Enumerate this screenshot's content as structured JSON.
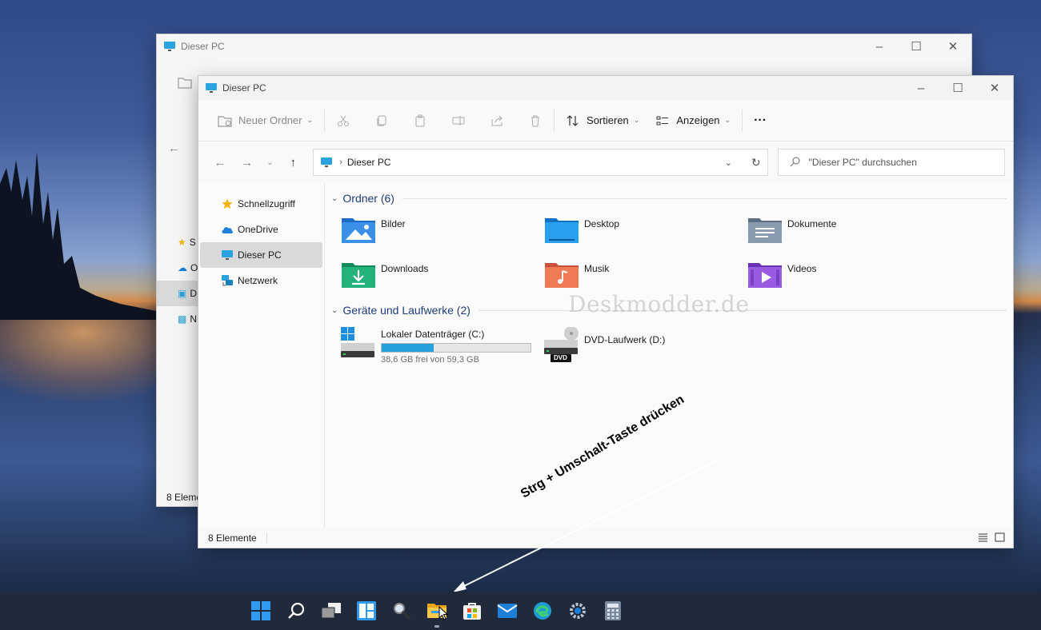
{
  "back_window": {
    "title": "Dieser PC",
    "nav_letters": [
      "S",
      "O",
      "D",
      "N"
    ],
    "status": "8 Eleme"
  },
  "window": {
    "title": "Dieser PC",
    "toolbar": {
      "new_folder": "Neuer Ordner",
      "sort": "Sortieren",
      "view": "Anzeigen",
      "more": "···"
    },
    "address": {
      "crumb": "Dieser PC",
      "search_placeholder": "\"Dieser PC\" durchsuchen"
    },
    "nav": [
      {
        "label": "Schnellzugriff",
        "icon": "star-icon"
      },
      {
        "label": "OneDrive",
        "icon": "cloud-icon"
      },
      {
        "label": "Dieser PC",
        "icon": "monitor-icon",
        "selected": true
      },
      {
        "label": "Netzwerk",
        "icon": "network-icon"
      }
    ],
    "groups": {
      "folders_title": "Ordner (6)",
      "drives_title": "Geräte und Laufwerke (2)"
    },
    "folders": [
      {
        "name": "Bilder",
        "icon": "pictures-folder-icon",
        "color": "#2f7fd8"
      },
      {
        "name": "Desktop",
        "icon": "desktop-folder-icon",
        "color": "#1e8fe0"
      },
      {
        "name": "Dokumente",
        "icon": "documents-folder-icon",
        "color": "#7f8fa3"
      },
      {
        "name": "Downloads",
        "icon": "downloads-folder-icon",
        "color": "#1fa670"
      },
      {
        "name": "Musik",
        "icon": "music-folder-icon",
        "color": "#e06a4a"
      },
      {
        "name": "Videos",
        "icon": "videos-folder-icon",
        "color": "#8a4fd0"
      }
    ],
    "drives": [
      {
        "name": "Lokaler Datenträger (C:)",
        "free": "38,6 GB frei von 59,3 GB",
        "used_fraction": 0.349
      },
      {
        "name": "DVD-Laufwerk (D:)",
        "badge": "DVD"
      }
    ],
    "status": "8 Elemente"
  },
  "watermark": "Deskmodder.de",
  "annotation": "Strg + Umschalt-Taste drücken",
  "taskbar": [
    "start-icon",
    "search-icon",
    "task-view-icon",
    "widgets-icon",
    "magnifier-icon",
    "file-explorer-icon",
    "store-icon",
    "mail-icon",
    "edge-icon",
    "settings-icon",
    "calculator-icon"
  ],
  "colors": {
    "accent": "#26a0da",
    "group_header": "#1f3d7a",
    "taskbar": "#202a3a"
  }
}
